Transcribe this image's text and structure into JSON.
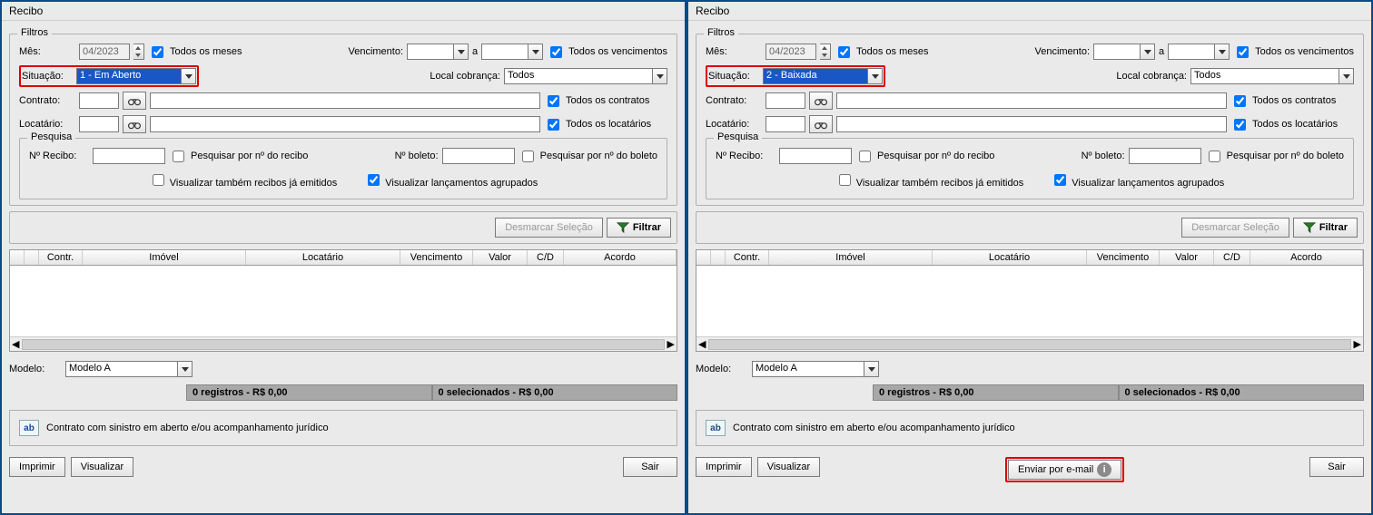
{
  "panes": [
    {
      "title": "Recibo",
      "filtros_legend": "Filtros",
      "mes_label": "Mês:",
      "mes_value": "04/2023",
      "todos_meses": "Todos os meses",
      "venc_label": "Vencimento:",
      "venc_a": "a",
      "todos_venc": "Todos os vencimentos",
      "situacao_label": "Situação:",
      "situacao_value": "1 - Em Aberto",
      "local_label": "Local cobrança:",
      "local_value": "Todos",
      "contrato_label": "Contrato:",
      "todos_contratos": "Todos os contratos",
      "locatario_label": "Locatário:",
      "todos_locatarios": "Todos os locatários",
      "pesquisa_legend": "Pesquisa",
      "n_recibo_label": "Nº Recibo:",
      "pesq_recibo": "Pesquisar por nº do recibo",
      "n_boleto_label": "Nº boleto:",
      "pesq_boleto": "Pesquisar por nº do boleto",
      "vis_emitidos": "Visualizar também recibos já emitidos",
      "vis_agrupados": "Visualizar lançamentos agrupados",
      "desmarcar": "Desmarcar Seleção",
      "filtrar": "Filtrar",
      "cols": {
        "contr": "Contr.",
        "imovel": "Imóvel",
        "locatario": "Locatário",
        "vencimento": "Vencimento",
        "valor": "Valor",
        "cd": "C/D",
        "acordo": "Acordo"
      },
      "modelo_label": "Modelo:",
      "modelo_value": "Modelo A",
      "status_reg": "0 registros - R$ 0,00",
      "status_sel": "0 selecionados - R$ 0,00",
      "legend_text": "Contrato com sinistro em aberto e/ou acompanhamento jurídico",
      "imprimir": "Imprimir",
      "visualizar": "Visualizar",
      "sair": "Sair",
      "show_email": false,
      "enviar_email": ""
    },
    {
      "title": "Recibo",
      "filtros_legend": "Filtros",
      "mes_label": "Mês:",
      "mes_value": "04/2023",
      "todos_meses": "Todos os meses",
      "venc_label": "Vencimento:",
      "venc_a": "a",
      "todos_venc": "Todos os vencimentos",
      "situacao_label": "Situação:",
      "situacao_value": "2 - Baixada",
      "local_label": "Local cobrança:",
      "local_value": "Todos",
      "contrato_label": "Contrato:",
      "todos_contratos": "Todos os contratos",
      "locatario_label": "Locatário:",
      "todos_locatarios": "Todos os locatários",
      "pesquisa_legend": "Pesquisa",
      "n_recibo_label": "Nº Recibo:",
      "pesq_recibo": "Pesquisar por nº do recibo",
      "n_boleto_label": "Nº boleto:",
      "pesq_boleto": "Pesquisar por nº do boleto",
      "vis_emitidos": "Visualizar também recibos já emitidos",
      "vis_agrupados": "Visualizar lançamentos agrupados",
      "desmarcar": "Desmarcar Seleção",
      "filtrar": "Filtrar",
      "cols": {
        "contr": "Contr.",
        "imovel": "Imóvel",
        "locatario": "Locatário",
        "vencimento": "Vencimento",
        "valor": "Valor",
        "cd": "C/D",
        "acordo": "Acordo"
      },
      "modelo_label": "Modelo:",
      "modelo_value": "Modelo A",
      "status_reg": "0 registros - R$ 0,00",
      "status_sel": "0 selecionados - R$ 0,00",
      "legend_text": "Contrato com sinistro em aberto e/ou acompanhamento jurídico",
      "imprimir": "Imprimir",
      "visualizar": "Visualizar",
      "sair": "Sair",
      "show_email": true,
      "enviar_email": "Enviar por e-mail"
    }
  ]
}
